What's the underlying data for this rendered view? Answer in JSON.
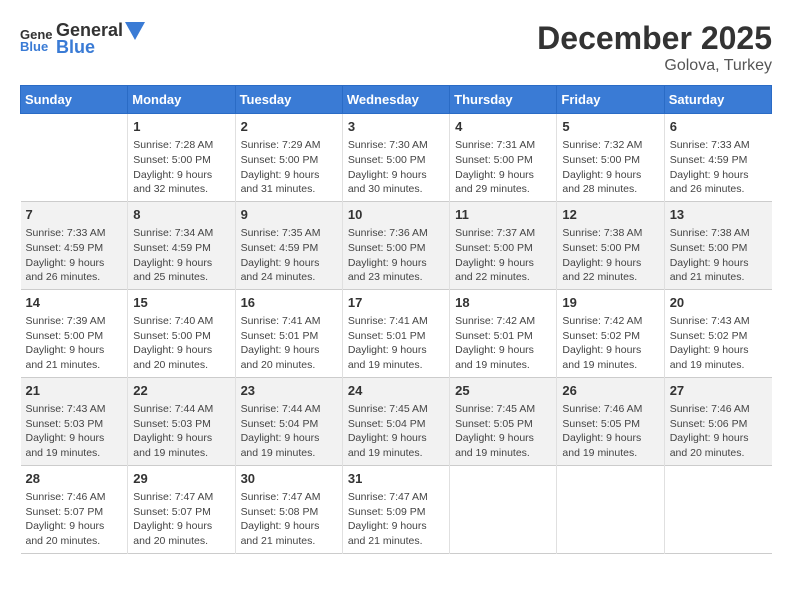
{
  "header": {
    "logo_general": "General",
    "logo_blue": "Blue",
    "month": "December 2025",
    "location": "Golova, Turkey"
  },
  "weekdays": [
    "Sunday",
    "Monday",
    "Tuesday",
    "Wednesday",
    "Thursday",
    "Friday",
    "Saturday"
  ],
  "weeks": [
    [
      {
        "num": "",
        "info": ""
      },
      {
        "num": "1",
        "info": "Sunrise: 7:28 AM\nSunset: 5:00 PM\nDaylight: 9 hours\nand 32 minutes."
      },
      {
        "num": "2",
        "info": "Sunrise: 7:29 AM\nSunset: 5:00 PM\nDaylight: 9 hours\nand 31 minutes."
      },
      {
        "num": "3",
        "info": "Sunrise: 7:30 AM\nSunset: 5:00 PM\nDaylight: 9 hours\nand 30 minutes."
      },
      {
        "num": "4",
        "info": "Sunrise: 7:31 AM\nSunset: 5:00 PM\nDaylight: 9 hours\nand 29 minutes."
      },
      {
        "num": "5",
        "info": "Sunrise: 7:32 AM\nSunset: 5:00 PM\nDaylight: 9 hours\nand 28 minutes."
      },
      {
        "num": "6",
        "info": "Sunrise: 7:33 AM\nSunset: 4:59 PM\nDaylight: 9 hours\nand 26 minutes."
      }
    ],
    [
      {
        "num": "7",
        "info": "Sunrise: 7:33 AM\nSunset: 4:59 PM\nDaylight: 9 hours\nand 26 minutes."
      },
      {
        "num": "8",
        "info": "Sunrise: 7:34 AM\nSunset: 4:59 PM\nDaylight: 9 hours\nand 25 minutes."
      },
      {
        "num": "9",
        "info": "Sunrise: 7:35 AM\nSunset: 4:59 PM\nDaylight: 9 hours\nand 24 minutes."
      },
      {
        "num": "10",
        "info": "Sunrise: 7:36 AM\nSunset: 5:00 PM\nDaylight: 9 hours\nand 23 minutes."
      },
      {
        "num": "11",
        "info": "Sunrise: 7:37 AM\nSunset: 5:00 PM\nDaylight: 9 hours\nand 22 minutes."
      },
      {
        "num": "12",
        "info": "Sunrise: 7:38 AM\nSunset: 5:00 PM\nDaylight: 9 hours\nand 22 minutes."
      },
      {
        "num": "13",
        "info": "Sunrise: 7:38 AM\nSunset: 5:00 PM\nDaylight: 9 hours\nand 21 minutes."
      }
    ],
    [
      {
        "num": "14",
        "info": "Sunrise: 7:39 AM\nSunset: 5:00 PM\nDaylight: 9 hours\nand 21 minutes."
      },
      {
        "num": "15",
        "info": "Sunrise: 7:40 AM\nSunset: 5:00 PM\nDaylight: 9 hours\nand 20 minutes."
      },
      {
        "num": "16",
        "info": "Sunrise: 7:41 AM\nSunset: 5:01 PM\nDaylight: 9 hours\nand 20 minutes."
      },
      {
        "num": "17",
        "info": "Sunrise: 7:41 AM\nSunset: 5:01 PM\nDaylight: 9 hours\nand 19 minutes."
      },
      {
        "num": "18",
        "info": "Sunrise: 7:42 AM\nSunset: 5:01 PM\nDaylight: 9 hours\nand 19 minutes."
      },
      {
        "num": "19",
        "info": "Sunrise: 7:42 AM\nSunset: 5:02 PM\nDaylight: 9 hours\nand 19 minutes."
      },
      {
        "num": "20",
        "info": "Sunrise: 7:43 AM\nSunset: 5:02 PM\nDaylight: 9 hours\nand 19 minutes."
      }
    ],
    [
      {
        "num": "21",
        "info": "Sunrise: 7:43 AM\nSunset: 5:03 PM\nDaylight: 9 hours\nand 19 minutes."
      },
      {
        "num": "22",
        "info": "Sunrise: 7:44 AM\nSunset: 5:03 PM\nDaylight: 9 hours\nand 19 minutes."
      },
      {
        "num": "23",
        "info": "Sunrise: 7:44 AM\nSunset: 5:04 PM\nDaylight: 9 hours\nand 19 minutes."
      },
      {
        "num": "24",
        "info": "Sunrise: 7:45 AM\nSunset: 5:04 PM\nDaylight: 9 hours\nand 19 minutes."
      },
      {
        "num": "25",
        "info": "Sunrise: 7:45 AM\nSunset: 5:05 PM\nDaylight: 9 hours\nand 19 minutes."
      },
      {
        "num": "26",
        "info": "Sunrise: 7:46 AM\nSunset: 5:05 PM\nDaylight: 9 hours\nand 19 minutes."
      },
      {
        "num": "27",
        "info": "Sunrise: 7:46 AM\nSunset: 5:06 PM\nDaylight: 9 hours\nand 20 minutes."
      }
    ],
    [
      {
        "num": "28",
        "info": "Sunrise: 7:46 AM\nSunset: 5:07 PM\nDaylight: 9 hours\nand 20 minutes."
      },
      {
        "num": "29",
        "info": "Sunrise: 7:47 AM\nSunset: 5:07 PM\nDaylight: 9 hours\nand 20 minutes."
      },
      {
        "num": "30",
        "info": "Sunrise: 7:47 AM\nSunset: 5:08 PM\nDaylight: 9 hours\nand 21 minutes."
      },
      {
        "num": "31",
        "info": "Sunrise: 7:47 AM\nSunset: 5:09 PM\nDaylight: 9 hours\nand 21 minutes."
      },
      {
        "num": "",
        "info": ""
      },
      {
        "num": "",
        "info": ""
      },
      {
        "num": "",
        "info": ""
      }
    ]
  ]
}
